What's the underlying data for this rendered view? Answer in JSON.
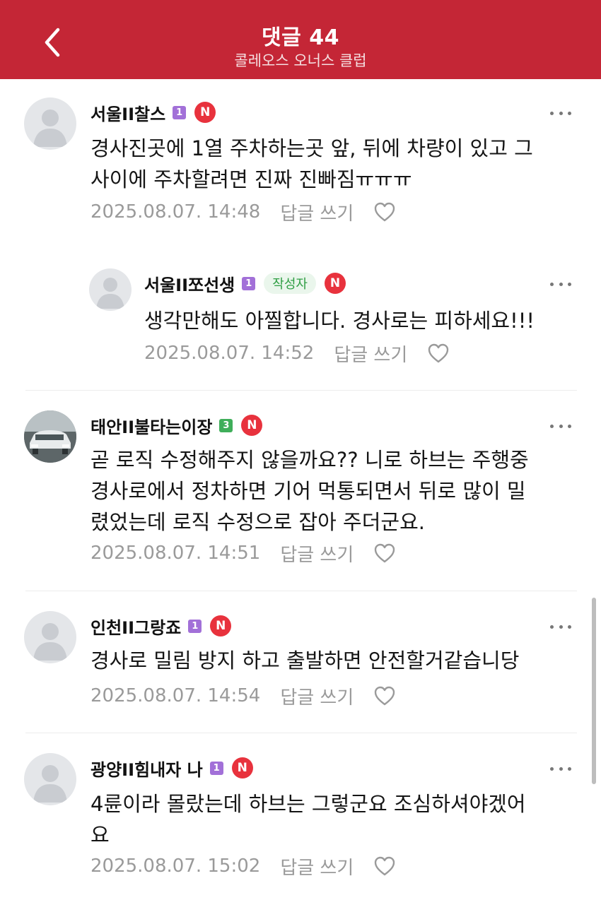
{
  "header": {
    "title": "댓글 44",
    "subtitle": "콜레오스 오너스 클럽"
  },
  "colors": {
    "header_bg": "#c42636",
    "level_1": "#a270d8",
    "level_3": "#3fae5a",
    "n_badge": "#e8323d",
    "author_badge_text": "#2f9e44"
  },
  "icons": {
    "back": "chevron-left-icon",
    "more": "more-horizontal-icon",
    "like": "heart-outline-icon",
    "avatar_default": "user-silhouette-icon",
    "n_badge": "n-badge-icon"
  },
  "comments": [
    {
      "nickname": "서울II찰스",
      "level": "1",
      "text_lines": [
        "경사진곳에 1열 주차하는곳 앞, 뒤에 차량이 있고 그",
        "사이에 주차할려면 진짜 진빠짐ㅠㅠㅠ"
      ],
      "date": "2025.08.07. 14:48",
      "reply_label": "답글 쓰기",
      "n_label": "N"
    },
    {
      "nickname": "서울II쪼선생",
      "level": "1",
      "author_badge": "작성자",
      "text_lines": [
        "생각만해도 아찔합니다. 경사로는 피하세요!!!"
      ],
      "date": "2025.08.07. 14:52",
      "reply_label": "답글 쓰기",
      "n_label": "N"
    },
    {
      "nickname": "태안II불타는이장",
      "level": "3",
      "text_lines": [
        "곧 로직 수정해주지 않을까요?? 니로 하브는 주행중",
        "경사로에서 정차하면 기어 먹통되면서 뒤로 많이 밀",
        "렸었는데 로직 수정으로 잡아 주더군요."
      ],
      "date": "2025.08.07. 14:51",
      "reply_label": "답글 쓰기",
      "n_label": "N"
    },
    {
      "nickname": "인천II그랑죠",
      "level": "1",
      "text_lines": [
        "경사로 밀림 방지 하고 출발하면 안전할거같습니당"
      ],
      "date": "2025.08.07. 14:54",
      "reply_label": "답글 쓰기",
      "n_label": "N"
    },
    {
      "nickname": "광양II힘내자 나",
      "level": "1",
      "text_lines": [
        "4륜이라 몰랐는데 하브는 그렇군요 조심하셔야겠어",
        "요"
      ],
      "date": "2025.08.07. 15:02",
      "reply_label": "답글 쓰기",
      "n_label": "N"
    }
  ]
}
